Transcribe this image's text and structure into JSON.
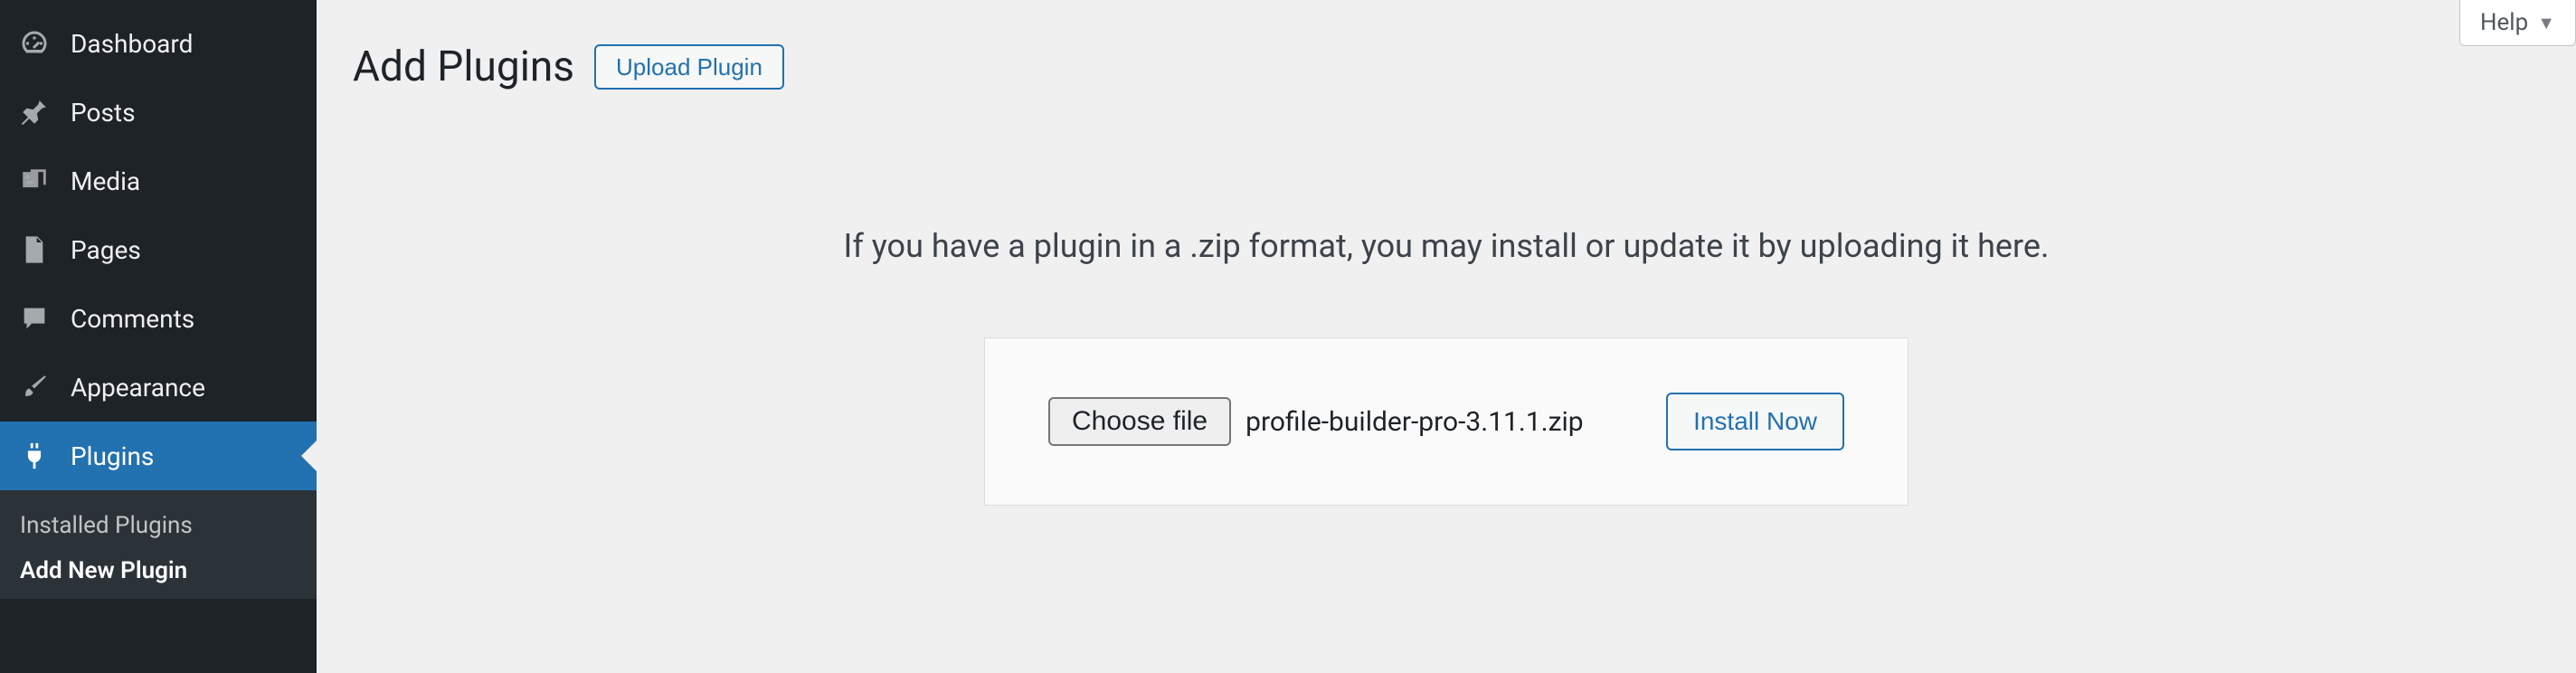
{
  "sidebar": {
    "items": [
      {
        "label": "Dashboard"
      },
      {
        "label": "Posts"
      },
      {
        "label": "Media"
      },
      {
        "label": "Pages"
      },
      {
        "label": "Comments"
      },
      {
        "label": "Appearance"
      },
      {
        "label": "Plugins"
      }
    ],
    "submenu": [
      {
        "label": "Installed Plugins"
      },
      {
        "label": "Add New Plugin"
      }
    ]
  },
  "header": {
    "title": "Add Plugins",
    "upload_button": "Upload Plugin",
    "help": "Help"
  },
  "upload_panel": {
    "instruction": "If you have a plugin in a .zip format, you may install or update it by uploading it here.",
    "choose_file": "Choose file",
    "filename": "profile-builder-pro-3.11.1.zip",
    "install_button": "Install Now"
  }
}
